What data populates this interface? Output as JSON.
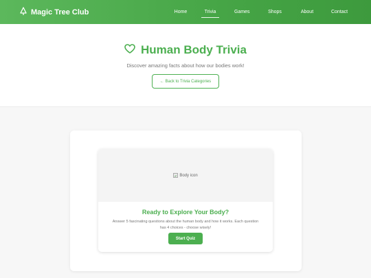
{
  "nav": {
    "brand": "Magic Tree Club",
    "links": [
      {
        "label": "Home"
      },
      {
        "label": "Trivia"
      },
      {
        "label": "Games"
      },
      {
        "label": "Shops"
      },
      {
        "label": "About"
      },
      {
        "label": "Contact"
      }
    ],
    "active": "Trivia"
  },
  "hero": {
    "title": "Human Body Trivia",
    "subtitle": "Discover amazing facts about how our bodies work!",
    "back_button": "← Back to Trivia Categories"
  },
  "quiz_card": {
    "image_alt": "Body icon",
    "title": "Ready to Explore Your Body?",
    "description": "Answer 5 fascinating questions about the human body and how it works. Each question has 4 choices - choose wisely!",
    "start_button": "Start Quiz"
  },
  "colors": {
    "brand_green": "#4caf50",
    "nav_gradient_start": "#5cb85c",
    "nav_gradient_end": "#3d9a3d"
  },
  "icons": {
    "brand": "tree-icon",
    "title": "heart-icon",
    "image": "broken-image-icon"
  }
}
